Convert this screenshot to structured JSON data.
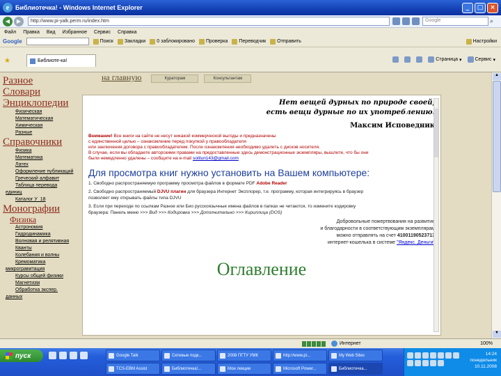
{
  "window": {
    "title": "Библиотечка! - Windows Internet Explorer"
  },
  "address": {
    "url": "http://www.pi-yalk.perm.ru/index.htm",
    "search_placeholder": "Google"
  },
  "menu": [
    "Файл",
    "Правка",
    "Вид",
    "Избранное",
    "Сервис",
    "Справка"
  ],
  "google_toolbar": {
    "logo": "Google",
    "items": [
      "Поиск",
      "Закладки",
      "0 заблокировано",
      "Проверка",
      "Переводчик",
      "Отправить"
    ],
    "settings": "Настройки"
  },
  "tab": {
    "label": "Библиоте-ка!"
  },
  "tab_tools": {
    "page": "Страница",
    "service": "Сервис"
  },
  "sidebar": {
    "h_misc": "Разное",
    "h_dict": "Словари",
    "h_enc": "Энциклопедии",
    "enc_links": [
      "Физическая",
      "Математическая",
      "Химическая",
      "Разные"
    ],
    "h_ref": "Справочники",
    "ref_links": [
      "Физика",
      "Математика",
      "Латех",
      "Оформление публикаций",
      "Греческий алфавит",
      "Таблица перевода"
    ],
    "ref_extra": [
      "единиц",
      "Каталог У_18"
    ],
    "h_mono": "Монографии",
    "h_phys": "Физика",
    "phys_links": [
      "Астрономия",
      "Гидродинамика",
      "Волновая и релятивная",
      "Кванты",
      "Колебания и волны",
      "Кремоматика"
    ],
    "phys_extra": [
      "микрогравитация",
      "Курсы общей физики",
      "Магнетизм",
      "Обработка экспер.",
      "данных"
    ]
  },
  "topnav": {
    "home": "на главную",
    "btn1": "Кураторам",
    "btn2": "Консультантам"
  },
  "content": {
    "quote_line1": "Нет вещей дурных по природе своей,",
    "quote_line2": "есть вещи дурные по их употреблению.",
    "author": "Максим Исповедник",
    "warn_bold": "Внимание!",
    "warn_line1": " Все книги на сайте не несут никакой коммерческой выгоды и предназначены",
    "warn_line2": "с единственной целью – ознакомление перед покупкой у правообладателя",
    "warn_line3": "или заключения договора с правообладателем. После ознакомления необходимо удалить с дисков носителя.",
    "warn_line4": "В случае, если вы обладаете авторскими правами на предоставленные здесь демонстрационные экземпляры, вышлите, что бы они",
    "warn_line5": "были немедленно удалены – сообщите на e-mail",
    "warn_email": "solitun143@gmail.com",
    "install_title": "Для просмотра книг нужно установить на Вашем компьютере:",
    "step1": "1. Свободно распространяемую программу просмотра файлов в формате PDF",
    "step1_link": "Adobe Reader",
    "step2a": "2. Свободно распространяемый",
    "step2_link": "DJVU плагин",
    "step2b": "для браузера Интернет Эксплорер, т.е. программу, которая интегрируясь в браузер",
    "step2c": "позволяет ему открывать файлы типа DJVU",
    "step3": "3. Если при переходе по ссылкам Разное или Био русскоязычные имена файлов в папках не читаются, то измените кодировку",
    "step3b": "браузера: Панель меню >>>",
    "step3_path": "Вид >>> Кодировка >>> Дополнительно >>> Кириллица (DOS)",
    "donate1": "Добровольные пожертвования на развитие",
    "donate2": "и благодарности в соответствующим экземплярам",
    "donate3": "можно отправлять на счет",
    "donate_num": "41001190523713",
    "donate4": "интернет-кошелька в системе",
    "donate_link": "\"Яндекс. Деньги\"",
    "toc": "Оглавление"
  },
  "status": {
    "zone": "Интернет",
    "zoom": "100%"
  },
  "taskbar": {
    "start": "пуск",
    "buttons": [
      "Google Talk",
      "Сетевые подк...",
      "2008 ПГТУ УМК",
      "http://www.pi...",
      "My Web Sites",
      "TCS-EBM Assist",
      "Библиотечка!...",
      "Мои лекции",
      "Microsoft Power...",
      "Библиотечка..."
    ],
    "time": "14:24",
    "day": "понедельник",
    "date": "10.11.2008"
  }
}
